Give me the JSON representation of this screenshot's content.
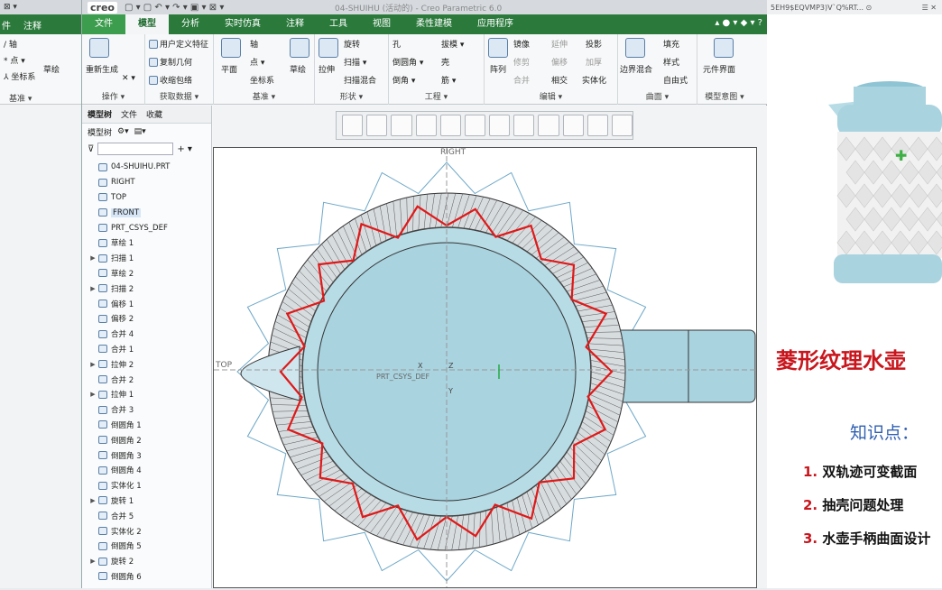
{
  "bg_window": {
    "title_icons": "⊠ ▾",
    "tabs": [
      "件",
      "注释"
    ],
    "ribbon_items": [
      "/ 轴",
      "* 点 ▾",
      "⅄ 坐标系",
      "草绘"
    ],
    "group_label": "基准 ▾"
  },
  "window": {
    "logo": "creo",
    "qat": "▢ ▾  ▢  ↶ ▾  ↷ ▾  ▣ ▾  ⊠ ▾",
    "title": "04-SHUIHU (活动的) - Creo Parametric 6.0",
    "tabs": [
      "文件",
      "模型",
      "分析",
      "实时仿真",
      "注释",
      "工具",
      "视图",
      "柔性建模",
      "应用程序"
    ],
    "right_icons": "▴ ● ▾ ◆ ▾ ?"
  },
  "ribbon": {
    "groups": [
      {
        "label": "操作 ▾",
        "items": [
          "重新生成",
          "✕ ▾"
        ]
      },
      {
        "label": "获取数据 ▾",
        "items": [
          "用户定义特征",
          "复制几何",
          "收缩包络"
        ]
      },
      {
        "label": "基准 ▾",
        "items": [
          "平面",
          "轴",
          "点 ▾",
          "坐标系",
          "草绘"
        ]
      },
      {
        "label": "形状 ▾",
        "items": [
          "拉伸",
          "旋转",
          "扫描 ▾",
          "扫描混合"
        ]
      },
      {
        "label": "工程 ▾",
        "items": [
          "孔",
          "倒圆角 ▾",
          "倒角 ▾",
          "拔模 ▾",
          "壳",
          "筋 ▾"
        ]
      },
      {
        "label": "编辑 ▾",
        "items": [
          "阵列",
          "镜像",
          "延伸",
          "投影",
          "修剪",
          "偏移",
          "加厚",
          "合并",
          "相交",
          "实体化"
        ]
      },
      {
        "label": "曲面 ▾",
        "items": [
          "边界混合",
          "填充",
          "样式",
          "自由式"
        ]
      },
      {
        "label": "模型意图 ▾",
        "items": [
          "元件界面"
        ]
      }
    ]
  },
  "tree": {
    "tabs": [
      "模型树",
      "文件",
      "收藏"
    ],
    "toolbar_label": "模型树",
    "rows": [
      {
        "label": "04-SHUIHU.PRT",
        "exp": ""
      },
      {
        "label": "RIGHT",
        "exp": ""
      },
      {
        "label": "TOP",
        "exp": ""
      },
      {
        "label": "FRONT",
        "exp": "",
        "selected": true
      },
      {
        "label": "PRT_CSYS_DEF",
        "exp": ""
      },
      {
        "label": "草绘 1",
        "exp": ""
      },
      {
        "label": "扫描 1",
        "exp": "▶"
      },
      {
        "label": "草绘 2",
        "exp": ""
      },
      {
        "label": "扫描 2",
        "exp": "▶"
      },
      {
        "label": "偏移 1",
        "exp": ""
      },
      {
        "label": "偏移 2",
        "exp": ""
      },
      {
        "label": "合并 4",
        "exp": ""
      },
      {
        "label": "合并 1",
        "exp": ""
      },
      {
        "label": "拉伸 2",
        "exp": "▶"
      },
      {
        "label": "合并 2",
        "exp": ""
      },
      {
        "label": "拉伸 1",
        "exp": "▶"
      },
      {
        "label": "合并 3",
        "exp": ""
      },
      {
        "label": "倒圆角 1",
        "exp": ""
      },
      {
        "label": "倒圆角 2",
        "exp": ""
      },
      {
        "label": "倒圆角 3",
        "exp": ""
      },
      {
        "label": "倒圆角 4",
        "exp": ""
      },
      {
        "label": "实体化 1",
        "exp": ""
      },
      {
        "label": "旋转 1",
        "exp": "▶"
      },
      {
        "label": "合并 5",
        "exp": ""
      },
      {
        "label": "实体化 2",
        "exp": ""
      },
      {
        "label": "倒圆角 5",
        "exp": ""
      },
      {
        "label": "旋转 2",
        "exp": "▶"
      },
      {
        "label": "倒圆角 6",
        "exp": ""
      }
    ]
  },
  "viewport": {
    "labels": {
      "right": "RIGHT",
      "top": "TOP",
      "csys": "PRT_CSYS_DEF",
      "x": "X",
      "y": "Y",
      "z": "Z"
    }
  },
  "right_panel": {
    "top_text": "5EH9$EQVMP3)V`Q%RT... ⊙",
    "top_icons": "☰ ✕",
    "title": "菱形纹理水壶",
    "knowledge": "知识点：",
    "points": [
      {
        "num": "1.",
        "text": "双轨迹可变截面"
      },
      {
        "num": "2.",
        "text": "抽壳问题处理"
      },
      {
        "num": "3.",
        "text": "水壶手柄曲面设计"
      }
    ]
  },
  "colors": {
    "accent": "#2b7a3c",
    "model": "#a9d3df",
    "highlight": "#e01818",
    "title_red": "#c8161d",
    "blue_text": "#2f5fb0"
  }
}
